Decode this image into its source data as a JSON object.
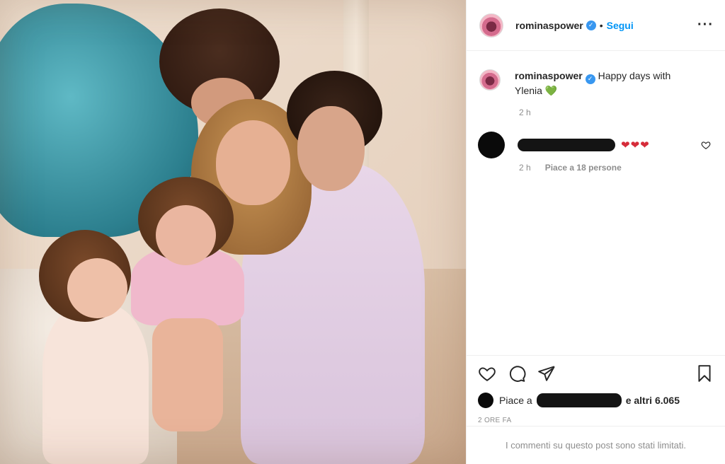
{
  "header": {
    "username": "rominaspower",
    "separator": "•",
    "follow_label": "Segui",
    "more_icon": "more-horizontal-icon"
  },
  "caption": {
    "username": "rominaspower",
    "text": "Happy days with Ylenia",
    "emoji": "💚",
    "time": "2 h"
  },
  "comment": {
    "username_redacted": true,
    "text": "❤❤❤",
    "time": "2 h",
    "likes_label": "Piace a 18 persone"
  },
  "actions": {
    "like_icon": "heart-icon",
    "comment_icon": "comment-icon",
    "share_icon": "share-icon",
    "save_icon": "bookmark-icon"
  },
  "likes": {
    "prefix": "Piace a",
    "suffix": "e altri 6.065"
  },
  "date_label": "2 ORE FA",
  "comments_limited": "I commenti su questo post sono stati limitati.",
  "colors": {
    "accent": "#0095f6",
    "verified": "#3897f0",
    "muted": "#8e8e8e"
  }
}
